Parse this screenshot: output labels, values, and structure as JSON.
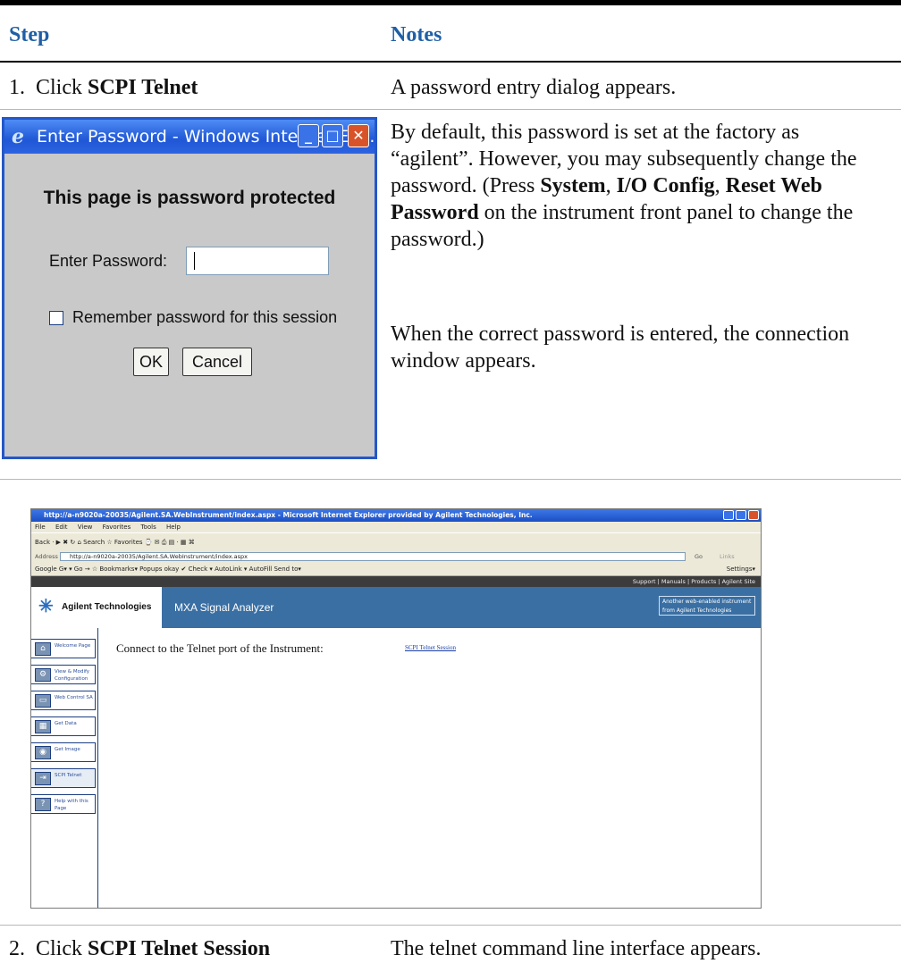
{
  "header": {
    "step": "Step",
    "notes": "Notes"
  },
  "row1": {
    "num": "1.",
    "action_prefix": "Click ",
    "action_bold": "SCPI Telnet",
    "note": "A password entry dialog appears."
  },
  "dialog": {
    "title": "Enter Password - Windows Internet Exp...",
    "heading": "This page is password protected",
    "password_label": "Enter Password:",
    "password_value": "",
    "remember_label": "Remember password for this session",
    "ok": "OK",
    "cancel": "Cancel"
  },
  "paragraph1": {
    "a": "By default, this password is set at the factory as “agilent”. However, you may subsequently change the password. (Press ",
    "b1": "System",
    "c1": ", ",
    "b2": "I/O Config",
    "c2": ", ",
    "b3": "Reset Web Password",
    "d": " on the instrument front panel to change the password.)"
  },
  "paragraph2": "When the correct password is entered, the connection window appears.",
  "browser": {
    "title": "http://a-n9020a-20035/Agilent.SA.WebInstrument/index.aspx - Microsoft Internet Explorer provided by Agilent Technologies, Inc.",
    "menu": [
      "File",
      "Edit",
      "View",
      "Favorites",
      "Tools",
      "Help"
    ],
    "toolbar_text": "Back  ·  ▶  ✖ ↻ ⌂  Search  ☆ Favorites  ⌚  ✉ ⎙  ▤ ·  ▦ ⌘",
    "address_label": "Address",
    "address": "http://a-n9020a-20035/Agilent.SA.WebInstrument/index.aspx",
    "go": "Go",
    "links": "Links",
    "google_bar": "Google G▾                              ▾  Go →  ☆ Bookmarks▾  Popups okay  ✔ Check ▾  AutoLink ▾  AutoFill  Send to▾",
    "settings": "Settings▾",
    "top_links": "Support | Manuals | Products | Agilent Site",
    "logo": "Agilent Technologies",
    "product": "MXA Signal Analyzer",
    "another": "Another web-enabled instrument from Agilent Technologies",
    "nav": [
      "Welcome Page",
      "View & Modify Configuration",
      "Web Control SA",
      "Get Data",
      "Get Image",
      "SCPI Telnet",
      "Help with this Page"
    ],
    "connect_text": "Connect to the Telnet port of the Instrument:",
    "telnet_link": "SCPI Telnet Session"
  },
  "row2": {
    "num": "2.",
    "action_prefix": "Click ",
    "action_bold": "SCPI Telnet Session",
    "note": "The telnet command line interface appears."
  }
}
